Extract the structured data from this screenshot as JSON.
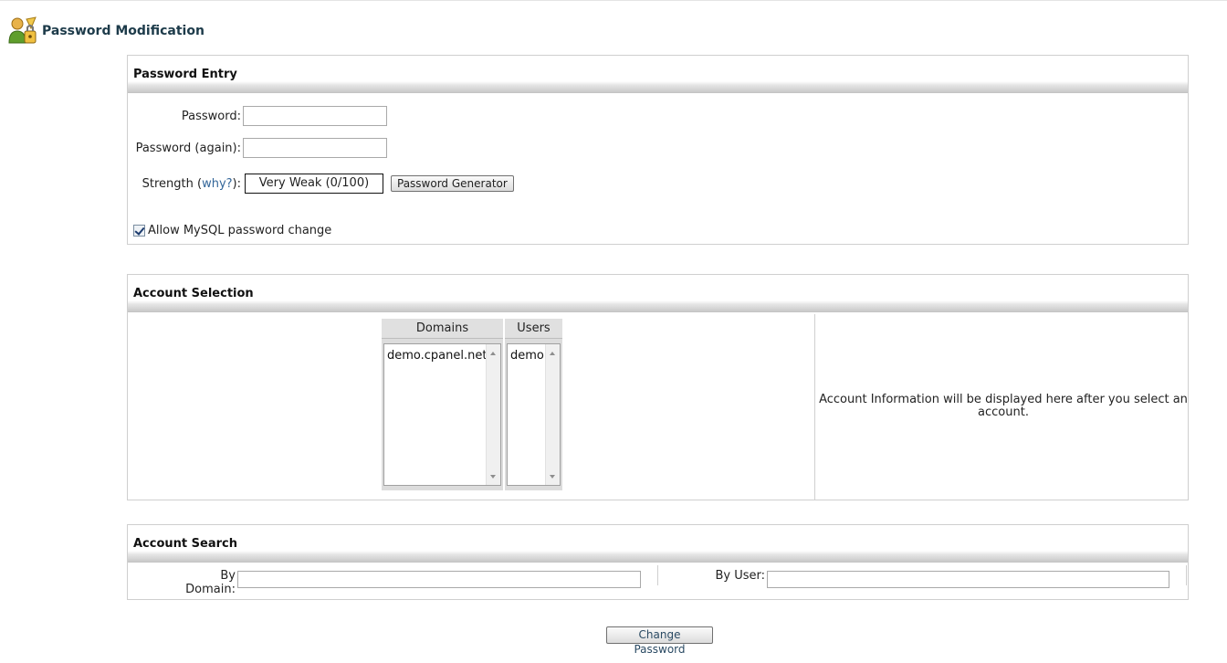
{
  "header": {
    "title": "Password Modification",
    "icon": "user-key-icon"
  },
  "password_entry": {
    "section_title": "Password Entry",
    "password_label": "Password:",
    "password_value": "",
    "password_again_label": "Password (again):",
    "password_again_value": "",
    "strength_label_prefix": "Strength (",
    "strength_link": "why?",
    "strength_label_suffix": "):",
    "strength_value": "Very Weak (0/100)",
    "generator_button": "Password Generator",
    "mysql_checkbox_label": "Allow MySQL password change",
    "mysql_checked": true
  },
  "account_selection": {
    "section_title": "Account Selection",
    "domains_header": "Domains",
    "domains": [
      "demo.cpanel.net"
    ],
    "users_header": "Users",
    "users": [
      "demo"
    ],
    "info_text": "Account Information will be displayed here after you select an account."
  },
  "account_search": {
    "section_title": "Account Search",
    "by_domain_label": "By Domain:",
    "by_domain_value": "",
    "by_user_label": "By User:",
    "by_user_value": ""
  },
  "actions": {
    "change_password": "Change Password"
  },
  "colors": {
    "title": "#1d3b4a",
    "link": "#336699",
    "border": "#cfcfcf"
  }
}
